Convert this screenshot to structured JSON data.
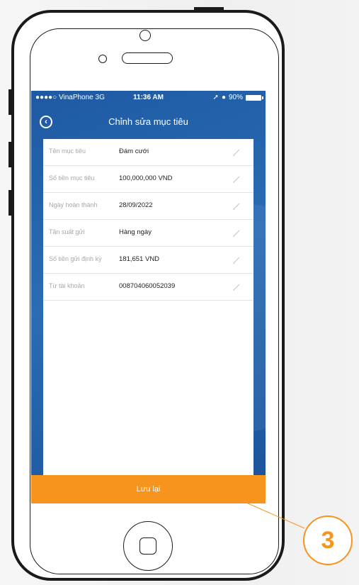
{
  "statusbar": {
    "carrier": "●●●●○ VinaPhone  3G",
    "time": "11:36 AM",
    "battery": "90%"
  },
  "header": {
    "title": "Chỉnh sửa mục tiêu",
    "back_icon": "back-circle-icon"
  },
  "form": {
    "rows": [
      {
        "label": "Tên mục tiêu",
        "value": "Đám cưới"
      },
      {
        "label": "Số tiền mục tiêu",
        "value": "100,000,000 VND"
      },
      {
        "label": "Ngày hoàn thành",
        "value": "28/09/2022"
      },
      {
        "label": "Tần suất gửi",
        "value": "Hàng ngày"
      },
      {
        "label": "Số tiền gửi định kỳ",
        "value": "181,651 VND"
      },
      {
        "label": "Từ tài khoản",
        "value": "0087040600520​39"
      }
    ]
  },
  "footer": {
    "save_label": "Lưu lại"
  },
  "callout": {
    "number": "3"
  },
  "colors": {
    "accent": "#f7941d",
    "header_blue": "#1e5aa3"
  }
}
